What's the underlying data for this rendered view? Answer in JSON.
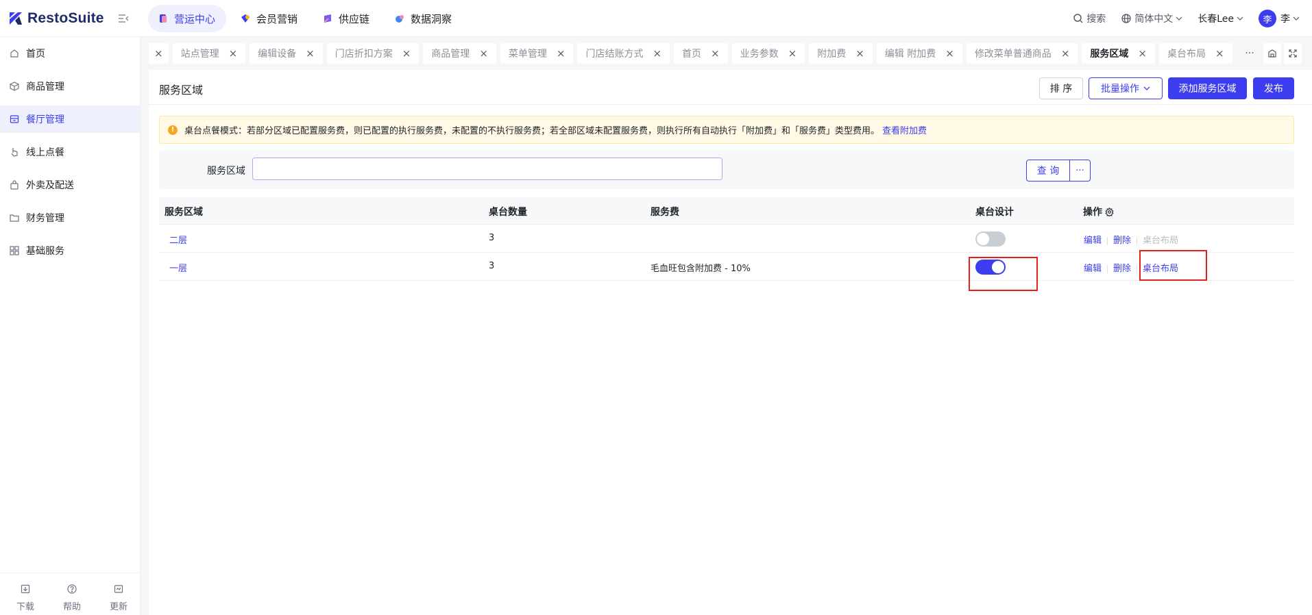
{
  "app": {
    "name": "RestoSuite"
  },
  "topnav": [
    {
      "label": "营运中心",
      "active": true
    },
    {
      "label": "会员营销",
      "active": false
    },
    {
      "label": "供应链",
      "active": false
    },
    {
      "label": "数据洞察",
      "active": false
    }
  ],
  "topright": {
    "search": "搜索",
    "language": "简体中文",
    "store": "长春Lee",
    "avatar": "李",
    "user": "李"
  },
  "sidebar": {
    "items": [
      {
        "label": "首页",
        "icon": "home-icon"
      },
      {
        "label": "商品管理",
        "icon": "box-icon"
      },
      {
        "label": "餐厅管理",
        "icon": "store-icon",
        "active": true
      },
      {
        "label": "线上点餐",
        "icon": "pointer-icon"
      },
      {
        "label": "外卖及配送",
        "icon": "bag-icon"
      },
      {
        "label": "财务管理",
        "icon": "folder-icon"
      },
      {
        "label": "基础服务",
        "icon": "grid-icon"
      }
    ],
    "bottom": [
      {
        "label": "下载",
        "icon": "download-icon"
      },
      {
        "label": "帮助",
        "icon": "help-icon"
      },
      {
        "label": "更新",
        "icon": "update-icon"
      }
    ]
  },
  "tabs": [
    {
      "label": "站点管理"
    },
    {
      "label": "编辑设备"
    },
    {
      "label": "门店折扣方案"
    },
    {
      "label": "商品管理"
    },
    {
      "label": "菜单管理"
    },
    {
      "label": "门店结账方式"
    },
    {
      "label": "首页"
    },
    {
      "label": "业务参数"
    },
    {
      "label": "附加费"
    },
    {
      "label": "编辑 附加费"
    },
    {
      "label": "修改菜单普通商品"
    },
    {
      "label": "服务区域",
      "active": true
    },
    {
      "label": "桌台布局"
    }
  ],
  "tabs_more": "···",
  "page": {
    "title": "服务区域",
    "buttons": {
      "sort": "排 序",
      "batch": "批量操作",
      "add": "添加服务区域",
      "publish": "发布"
    },
    "alert": {
      "icon": "!",
      "text": "桌台点餐模式：若部分区域已配置服务费，则已配置的执行服务费，未配置的不执行服务费；若全部区域未配置服务费，则执行所有自动执行「附加费」和「服务费」类型费用。",
      "link": "查看附加费"
    },
    "filter": {
      "label": "服务区域",
      "value": "",
      "query": "查 询",
      "more": "···"
    }
  },
  "table": {
    "headers": [
      "服务区域",
      "桌台数量",
      "服务费",
      "桌台设计",
      "操作"
    ],
    "rows": [
      {
        "area": "二层",
        "count": "3",
        "fee": "",
        "design_on": false,
        "edit": "编辑",
        "delete": "删除",
        "layout": "桌台布局",
        "layout_enabled": false
      },
      {
        "area": "一层",
        "count": "3",
        "fee": "毛血旺包含附加费 - 10%",
        "design_on": true,
        "edit": "编辑",
        "delete": "删除",
        "layout": "桌台布局",
        "layout_enabled": true
      }
    ]
  },
  "colors": {
    "accent": "#3d3df0",
    "highlight_box": "#e8201c",
    "alert_bg": "#fff9e6"
  }
}
